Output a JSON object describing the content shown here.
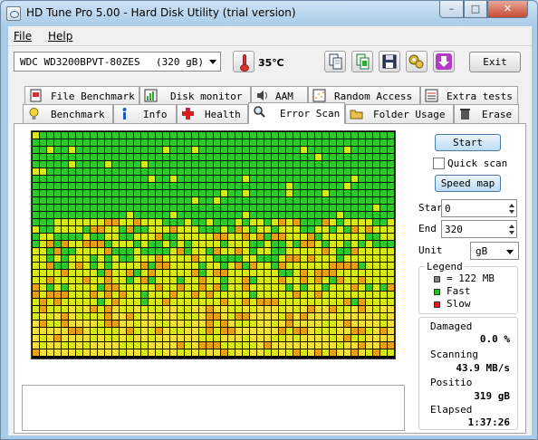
{
  "window": {
    "title": "HD Tune Pro 5.00 - Hard Disk Utility (trial version)",
    "minimize_glyph": "–",
    "maximize_glyph": "□",
    "close_glyph": "✕"
  },
  "menu": {
    "file": "File",
    "help": "Help"
  },
  "toolbar": {
    "drive_name": "WDC WD3200BPVT-80ZES",
    "drive_size": "(320 gB)",
    "temperature": "35℃",
    "exit_label": "Exit",
    "icons": [
      "copy-icon",
      "copy-all-icon",
      "save-icon",
      "options-icon",
      "download-icon"
    ]
  },
  "tabs_top": [
    {
      "label": "File Benchmark",
      "icon": "file-benchmark-icon"
    },
    {
      "label": "Disk monitor",
      "icon": "disk-monitor-icon"
    },
    {
      "label": "AAM",
      "icon": "speaker-icon"
    },
    {
      "label": "Random Access",
      "icon": "random-access-icon"
    },
    {
      "label": "Extra tests",
      "icon": "extra-tests-icon"
    }
  ],
  "tabs_bottom": [
    {
      "label": "Benchmark",
      "icon": "bulb-icon"
    },
    {
      "label": "Info",
      "icon": "info-icon"
    },
    {
      "label": "Health",
      "icon": "health-cross-icon"
    },
    {
      "label": "Error Scan",
      "icon": "magnifier-icon",
      "active": true
    },
    {
      "label": "Folder Usage",
      "icon": "folder-icon"
    },
    {
      "label": "Erase",
      "icon": "trash-icon"
    }
  ],
  "scan": {
    "start_label": "Start",
    "quick_scan_label": "Quick scan",
    "speed_map_label": "Speed map",
    "start_field_label": "Star",
    "start_value": "0",
    "end_field_label": "End",
    "end_value": "320",
    "unit_label": "Unit",
    "unit_value": "gB",
    "colors": {
      "fast": "#2fc62f",
      "medium": "#d7e81e",
      "slow_yellow": "#f4df3f",
      "slow": "#e8a01b",
      "border": "#4a4a4a"
    }
  },
  "legend": {
    "title": "Legend",
    "block_label": "= 122 MB",
    "fast_label": "Fast",
    "slow_label": "Slow",
    "block_color": "#808080",
    "fast_color": "#22c322",
    "slow_color": "#e51d1d"
  },
  "stats": {
    "damaged_label": "Damaged",
    "damaged_value": "0.0 %",
    "scanning_label": "Scanning",
    "scanning_value": "43.9 MB/s",
    "position_label": "Positio",
    "position_value": "319 gB",
    "elapsed_label": "Elapsed",
    "elapsed_value": "1:37:26"
  }
}
